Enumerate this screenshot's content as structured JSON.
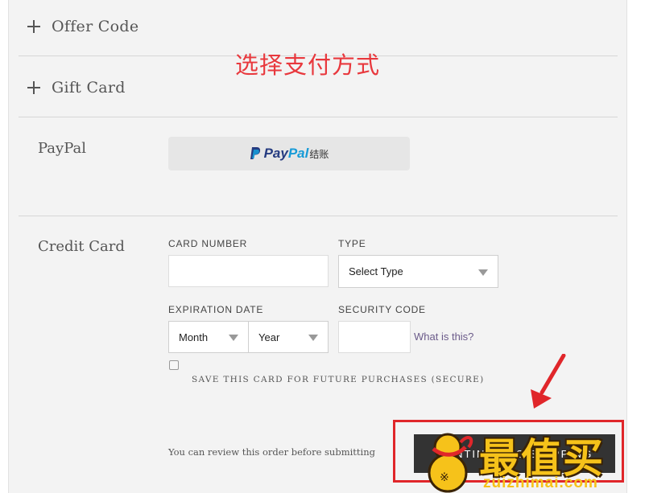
{
  "accordion": {
    "offer_code": {
      "label": "Offer Code",
      "icon": "plus-icon"
    },
    "gift_card": {
      "label": "Gift Card",
      "icon": "plus-icon"
    }
  },
  "annotation": {
    "text": "选择支付方式",
    "color": "#e8383d"
  },
  "paypal": {
    "section_title": "PayPal",
    "button": {
      "brand_part1": "Pay",
      "brand_part2": "Pal",
      "suffix": "结账",
      "icon": "paypal-logo-icon"
    }
  },
  "credit_card": {
    "section_title": "Credit Card",
    "card_number": {
      "label": "CARD NUMBER",
      "value": ""
    },
    "type": {
      "label": "TYPE",
      "selected": "Select Type"
    },
    "expiration": {
      "label": "EXPIRATION DATE",
      "month": "Month",
      "year": "Year"
    },
    "security_code": {
      "label": "SECURITY CODE",
      "value": "",
      "help_link": "What is this?"
    },
    "save_card": {
      "label": "SAVE THIS CARD FOR FUTURE PURCHASES (SECURE)",
      "checked": false
    }
  },
  "footer": {
    "review_note": "You can review this order before submitting",
    "continue_button": "CONTINUE TO SHIPPING"
  },
  "watermark": {
    "text": "最值买",
    "domain": "zuizhimai.com"
  },
  "colors": {
    "highlight": "#e0262a",
    "paypal_dark": "#253b80",
    "paypal_light": "#179bd7",
    "watermark": "#f6c21a"
  }
}
